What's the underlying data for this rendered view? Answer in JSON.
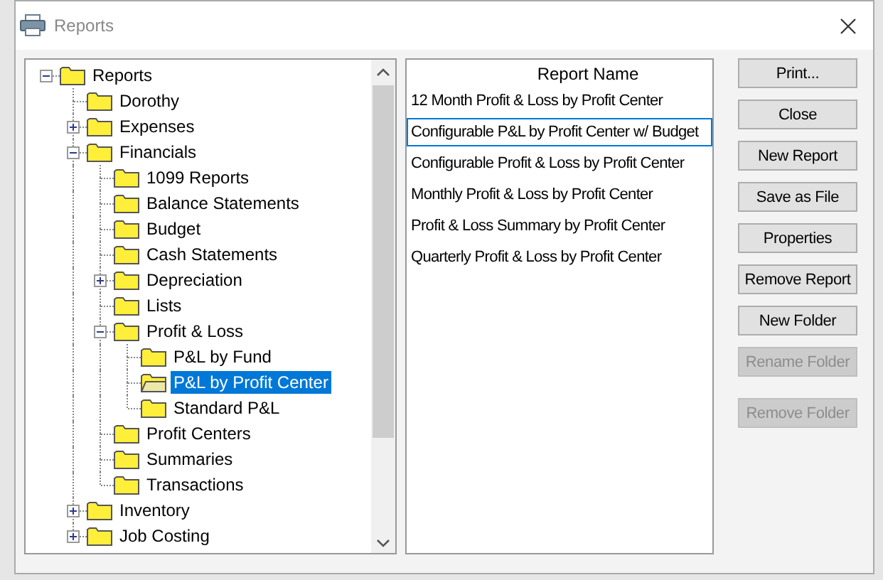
{
  "window": {
    "title": "Reports"
  },
  "tree": [
    {
      "label": "Reports",
      "expanded": true,
      "selected": false,
      "children": [
        {
          "label": "Dorothy",
          "selected": false
        },
        {
          "label": "Expenses",
          "expanded": false,
          "selected": false
        },
        {
          "label": "Financials",
          "expanded": true,
          "selected": false,
          "children": [
            {
              "label": "1099 Reports",
              "selected": false
            },
            {
              "label": "Balance Statements",
              "selected": false
            },
            {
              "label": "Budget",
              "selected": false
            },
            {
              "label": "Cash Statements",
              "selected": false
            },
            {
              "label": "Depreciation",
              "expanded": false,
              "selected": false
            },
            {
              "label": "Lists",
              "selected": false
            },
            {
              "label": "Profit & Loss",
              "expanded": true,
              "selected": false,
              "children": [
                {
                  "label": "P&L by Fund",
                  "selected": false
                },
                {
                  "label": "P&L by Profit Center",
                  "selected": true
                },
                {
                  "label": "Standard P&L",
                  "selected": false
                }
              ]
            },
            {
              "label": "Profit Centers",
              "selected": false
            },
            {
              "label": "Summaries",
              "selected": false
            },
            {
              "label": "Transactions",
              "selected": false
            }
          ]
        },
        {
          "label": "Inventory",
          "expanded": false,
          "selected": false
        },
        {
          "label": "Job Costing",
          "expanded": false,
          "selected": false
        }
      ]
    }
  ],
  "report_list": {
    "column": "Report Name",
    "rows": [
      {
        "name": "12 Month Profit & Loss by Profit Center",
        "selected": false
      },
      {
        "name": "Configurable P&L by Profit Center w/ Budget",
        "selected": true
      },
      {
        "name": "Configurable Profit & Loss by Profit Center",
        "selected": false
      },
      {
        "name": "Monthly Profit & Loss by Profit Center",
        "selected": false
      },
      {
        "name": "Profit & Loss Summary by Profit Center",
        "selected": false
      },
      {
        "name": "Quarterly Profit & Loss by Profit Center",
        "selected": false
      }
    ]
  },
  "buttons": [
    {
      "label": "Print...",
      "disabled": false
    },
    {
      "label": "Close",
      "disabled": false
    },
    {
      "label": "New Report",
      "disabled": false
    },
    {
      "label": "Save as File",
      "disabled": false
    },
    {
      "label": "Properties",
      "disabled": false
    },
    {
      "label": "Remove Report",
      "disabled": false
    },
    {
      "label": "New Folder",
      "disabled": false
    },
    {
      "label": "Rename Folder",
      "disabled": true
    },
    {
      "label": "Remove Folder",
      "disabled": true
    }
  ]
}
